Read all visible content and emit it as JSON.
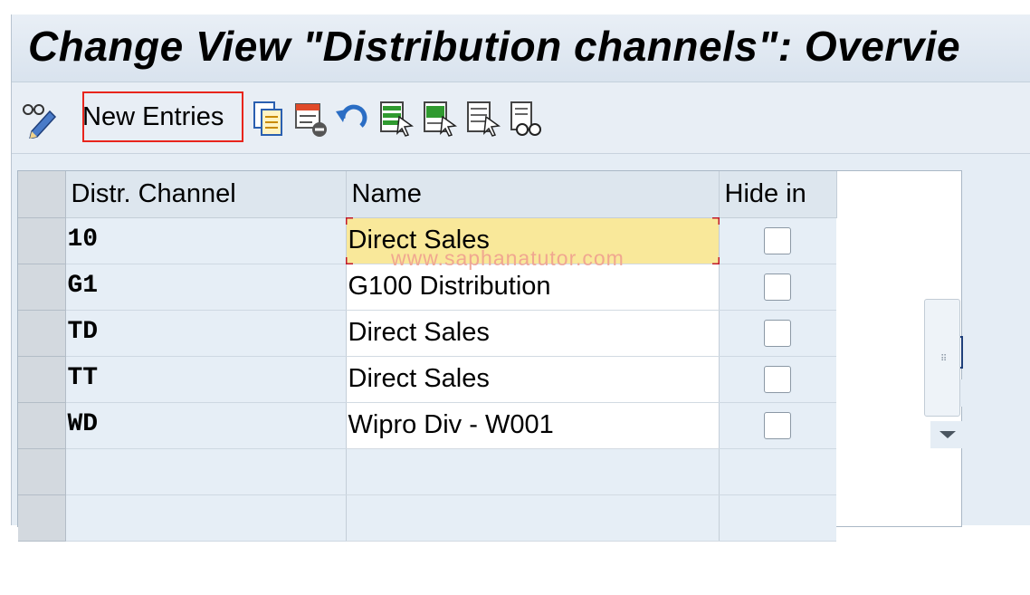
{
  "window": {
    "title": "Change View \"Distribution channels\": Overvie"
  },
  "toolbar": {
    "new_entries_label": "New Entries",
    "icons": [
      "display-change-icon",
      "copy-as-icon",
      "delete-icon",
      "undo-change-icon",
      "select-all-icon",
      "select-block-icon",
      "deselect-all-icon",
      "print-icon"
    ]
  },
  "table": {
    "columns": [
      "Distr. Channel",
      "Name",
      "Hide in"
    ],
    "rows": [
      {
        "code": "10",
        "name": "Direct Sales",
        "hide": false
      },
      {
        "code": "G1",
        "name": "G100 Distribution",
        "hide": false
      },
      {
        "code": "TD",
        "name": "Direct Sales",
        "hide": false
      },
      {
        "code": "TT",
        "name": "Direct Sales",
        "hide": false
      },
      {
        "code": "WD",
        "name": "Wipro Div - W001",
        "hide": false
      },
      {
        "code": "",
        "name": "",
        "hide": null
      },
      {
        "code": "",
        "name": "",
        "hide": null
      }
    ]
  },
  "watermark": "www.saphanatutor.com",
  "colors": {
    "highlight_box": "#e8251c",
    "active_cell": "#f9e89a",
    "header_bg": "#dde6ee",
    "frame_bg": "#e5edf5"
  }
}
